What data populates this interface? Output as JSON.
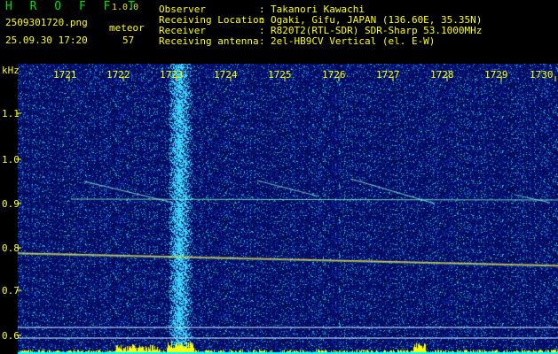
{
  "header": {
    "brand": "H R O F F T",
    "version": "1.0.0",
    "file_name": "2509301720.png",
    "datetime": "25.09.30 17:20",
    "meteor_label": "meteor",
    "meteor_count": "57",
    "fields": [
      {
        "label": "Observer",
        "value": "Takanori Kawachi"
      },
      {
        "label": "Receiving Location",
        "value": "Ogaki, Gifu, JAPAN (136.60E, 35.35N)"
      },
      {
        "label": "Receiver",
        "value": "R820T2(RTL-SDR) SDR-Sharp 53.1000MHz"
      },
      {
        "label": "Receiving antenna",
        "value": "2el-HB9CV Vertical (el. E-W)"
      }
    ]
  },
  "axes": {
    "y_unit": "kHz",
    "x_ticks": [
      "1721",
      "1722",
      "1723",
      "1724",
      "1725",
      "1726",
      "1727",
      "1728",
      "1729",
      "1730"
    ],
    "y_ticks": [
      "1.1",
      "1.0",
      "0.9",
      "0.8",
      "0.7",
      "0.6"
    ]
  },
  "colors": {
    "background_noise": "#0a1a8c",
    "text_yellow": "#ffff00",
    "text_cyan": "#00ffff",
    "brand_green": "#00e000",
    "spectrum_yellow": "#ffff00"
  }
}
